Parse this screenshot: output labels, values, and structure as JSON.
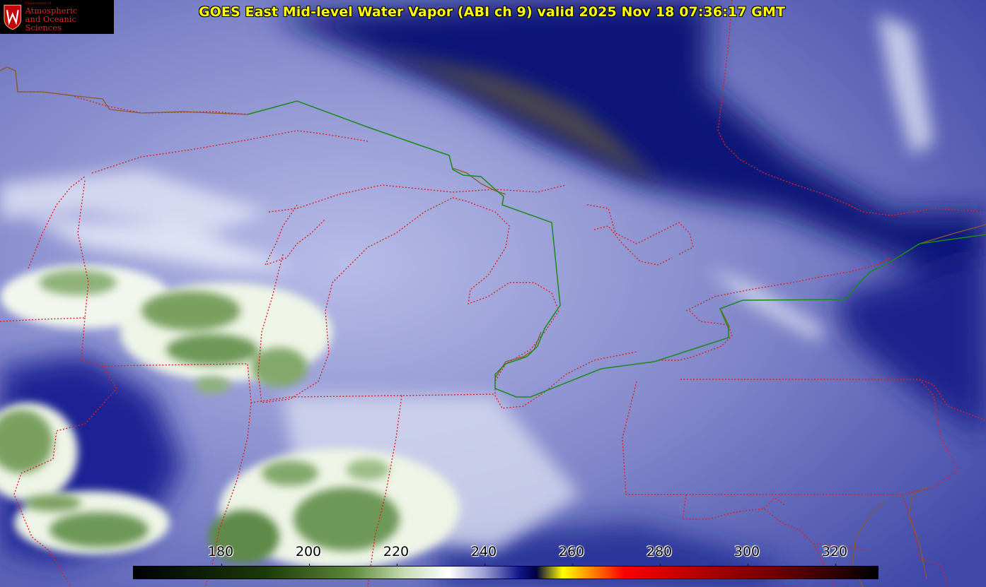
{
  "title": "GOES East Mid-level Water Vapor (ABI ch 9)  valid 2025 Nov 18 07:36:17 GMT",
  "logo": {
    "department": "Department of",
    "line1": "Atmospheric",
    "line2": "and Oceanic Sciences",
    "icon": "uw-crest-icon"
  },
  "colorbar": {
    "min": 160,
    "max": 330,
    "ticks": [
      {
        "value": 180,
        "label": "180"
      },
      {
        "value": 200,
        "label": "200"
      },
      {
        "value": 220,
        "label": "220"
      },
      {
        "value": 240,
        "label": "240"
      },
      {
        "value": 260,
        "label": "260"
      },
      {
        "value": 280,
        "label": "280"
      },
      {
        "value": 300,
        "label": "300"
      },
      {
        "value": 320,
        "label": "320"
      }
    ],
    "stops": [
      {
        "value": 160,
        "color": "#000000"
      },
      {
        "value": 190,
        "color": "#1a3a0a"
      },
      {
        "value": 210,
        "color": "#5e8a3a"
      },
      {
        "value": 222,
        "color": "#c8dcb8"
      },
      {
        "value": 232,
        "color": "#ffffff"
      },
      {
        "value": 240,
        "color": "#9ca0d4"
      },
      {
        "value": 248,
        "color": "#10188c"
      },
      {
        "value": 252,
        "color": "#000040"
      },
      {
        "value": 258,
        "color": "#ffff00"
      },
      {
        "value": 265,
        "color": "#ff8000"
      },
      {
        "value": 272,
        "color": "#ff0000"
      },
      {
        "value": 290,
        "color": "#b00000"
      },
      {
        "value": 310,
        "color": "#600000"
      },
      {
        "value": 330,
        "color": "#000000"
      }
    ]
  },
  "colors": {
    "state_borders": "#e02020",
    "international_border": "#1a8a1a",
    "coastline": "#8b5a2b",
    "title_text": "#ffff00"
  }
}
